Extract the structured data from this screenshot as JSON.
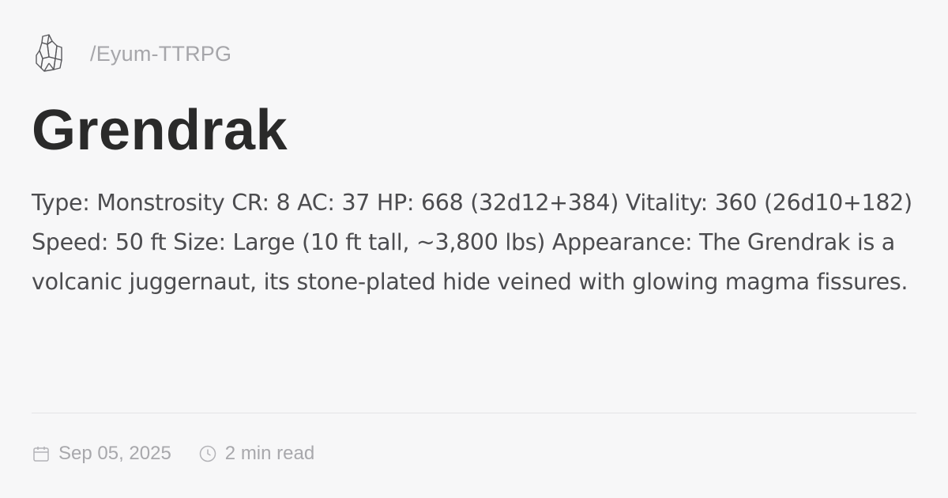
{
  "site": {
    "logo_icon": "crystal-icon",
    "path": "/Eyum-TTRPG"
  },
  "post": {
    "title": "Grendrak",
    "description": "Type: Monstrosity CR: 8 AC: 37 HP: 668 (32d12+384) Vitality: 360 (26d10+182) Speed: 50 ft Size: Large (10 ft tall, ~3,800 lbs) Appearance: The Grendrak is a volcanic juggernaut, its stone-plated hide veined with glowing magma fissures."
  },
  "meta": {
    "date_icon": "calendar-icon",
    "date": "Sep 05, 2025",
    "read_icon": "clock-icon",
    "read_time": "2 min read"
  },
  "colors": {
    "background": "#f7f7f8",
    "title": "#2a2a2a",
    "body_text": "#4c4c4f",
    "muted": "#a8a8ac"
  }
}
